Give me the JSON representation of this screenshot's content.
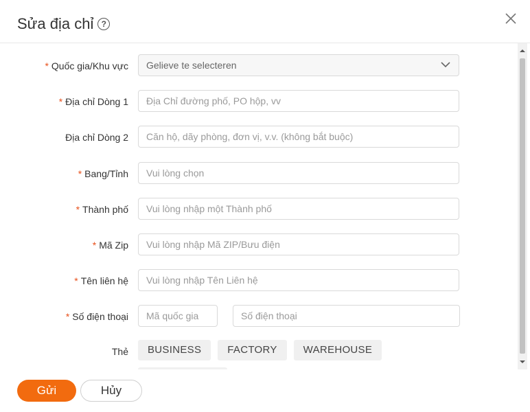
{
  "dialog": {
    "title": "Sửa địa chỉ",
    "help_icon": "?"
  },
  "form": {
    "country": {
      "label": "Quốc gia/Khu vực",
      "required": true,
      "value": "Gelieve te selecteren"
    },
    "address1": {
      "label": "Địa chỉ Dòng 1",
      "required": true,
      "placeholder": "Địa Chỉ đường phố, PO hộp, vv"
    },
    "address2": {
      "label": "Địa chỉ Dòng 2",
      "required": false,
      "placeholder": "Căn hộ, dãy phòng, đơn vị, v.v. (không bắt buộc)"
    },
    "state": {
      "label": "Bang/Tỉnh",
      "required": true,
      "placeholder": "Vui lòng chọn"
    },
    "city": {
      "label": "Thành phố",
      "required": true,
      "placeholder": "Vui lòng nhập một Thành phố"
    },
    "zip": {
      "label": "Mã Zip",
      "required": true,
      "placeholder": "Vui lòng nhập Mã ZIP/Bưu điện"
    },
    "contact": {
      "label": "Tên liên hệ",
      "required": true,
      "placeholder": "Vui lòng nhập Tên Liên hệ"
    },
    "phone": {
      "label": "Số điện thoại",
      "required": true,
      "code_placeholder": "Mã quốc gia",
      "number_placeholder": "Số điện thoại"
    },
    "tags": {
      "label": "Thẻ",
      "items": [
        "BUSINESS",
        "FACTORY",
        "WAREHOUSE"
      ]
    },
    "required_mark": "*"
  },
  "footer": {
    "submit_label": "Gửi",
    "cancel_label": "Hủy"
  },
  "colors": {
    "accent": "#f26b0f",
    "required": "#e8501b"
  }
}
